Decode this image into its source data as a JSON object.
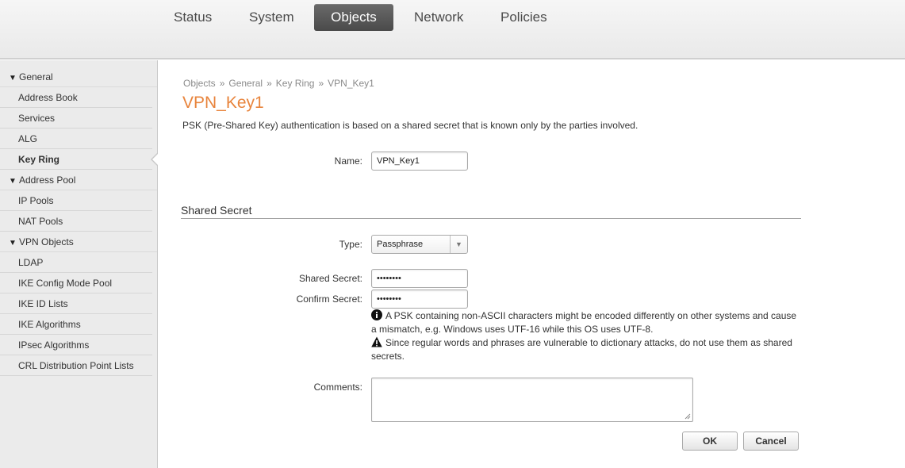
{
  "nav": {
    "tabs": [
      {
        "label": "Status"
      },
      {
        "label": "System"
      },
      {
        "label": "Objects"
      },
      {
        "label": "Network"
      },
      {
        "label": "Policies"
      }
    ]
  },
  "sidebar": {
    "groups": [
      {
        "label": "General",
        "items": [
          "Address Book",
          "Services",
          "ALG",
          "Key Ring"
        ]
      },
      {
        "label": "Address Pool",
        "items": [
          "IP Pools",
          "NAT Pools"
        ]
      },
      {
        "label": "VPN Objects",
        "items": [
          "LDAP",
          "IKE Config Mode Pool",
          "IKE ID Lists",
          "IKE Algorithms",
          "IPsec Algorithms",
          "CRL Distribution Point Lists"
        ]
      }
    ],
    "active_item": "Key Ring"
  },
  "breadcrumb": [
    "Objects",
    "General",
    "Key Ring",
    "VPN_Key1"
  ],
  "breadcrumb_separator": "»",
  "page": {
    "title": "VPN_Key1",
    "description": "PSK (Pre-Shared Key) authentication is based on a shared secret that is known only by the parties involved."
  },
  "form": {
    "name_label": "Name:",
    "name_value": "VPN_Key1",
    "section_title": "Shared Secret",
    "type_label": "Type:",
    "type_value": "Passphrase",
    "shared_secret_label": "Shared Secret:",
    "shared_secret_value": "••••••••",
    "confirm_secret_label": "Confirm Secret:",
    "confirm_secret_value": "••••••••",
    "info_note": "A PSK containing non-ASCII characters might be encoded differently on other systems and cause a mismatch, e.g. Windows uses UTF-16 while this OS uses UTF-8.",
    "warning_note": "Since regular words and phrases are vulnerable to dictionary attacks, do not use them as shared secrets.",
    "comments_label": "Comments:",
    "comments_value": "",
    "ok_label": "OK",
    "cancel_label": "Cancel"
  },
  "colors": {
    "accent": "#e8843c",
    "active_tab": "#555555",
    "sidebar_bg": "#ebebeb"
  }
}
